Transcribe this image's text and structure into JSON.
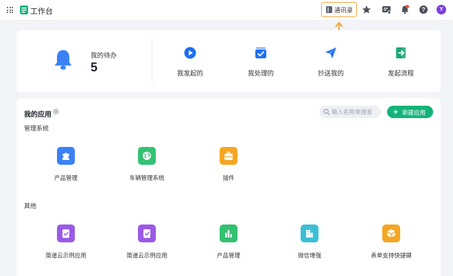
{
  "topbar": {
    "app_title": "工作台",
    "contacts_label": "通讯录",
    "avatar_letter": "Y",
    "icons": [
      "grid-menu-icon",
      "workbench-logo-icon",
      "contacts-book-icon",
      "star-icon",
      "message-board-icon",
      "bell-icon",
      "help-icon"
    ]
  },
  "summary": {
    "todo_label": "我的待办",
    "todo_count": "5",
    "quick_actions": [
      {
        "label": "我发起的",
        "icon": "play-circle-icon"
      },
      {
        "label": "我处理的",
        "icon": "check-box-icon"
      },
      {
        "label": "抄送我的",
        "icon": "send-plane-icon"
      },
      {
        "label": "发起流程",
        "icon": "start-process-icon"
      }
    ]
  },
  "apps": {
    "title": "我的应用",
    "search_placeholder": "输入名称来搜索",
    "new_app_label": "新建应用",
    "sections": [
      {
        "label": "管理系统",
        "items": [
          {
            "name": "产品管理",
            "icon": "puzzle-icon",
            "color": "#3b82f6"
          },
          {
            "name": "车辆管理系统",
            "icon": "globe-icon",
            "color": "#34c172"
          },
          {
            "name": "插件",
            "icon": "toolbox-icon",
            "color": "#f5a623"
          }
        ]
      },
      {
        "label": "其他",
        "items": [
          {
            "name": "简道云示例应用",
            "icon": "clipboard-check-icon",
            "color": "#9b59e6"
          },
          {
            "name": "简道云示例应用",
            "icon": "clipboard-check-icon",
            "color": "#9b59e6"
          },
          {
            "name": "产品管理",
            "icon": "bar-chart-icon",
            "color": "#34c172"
          },
          {
            "name": "微信增强",
            "icon": "building-icon",
            "color": "#3bbfd6"
          },
          {
            "name": "表单支持快捷键",
            "icon": "cube-icon",
            "color": "#f5a623"
          }
        ]
      }
    ]
  },
  "colors": {
    "accent_green": "#14b37a",
    "brand_blue": "#3b82f6",
    "highlight_orange": "#f0a73a",
    "avatar_purple": "#7a3fe0"
  }
}
